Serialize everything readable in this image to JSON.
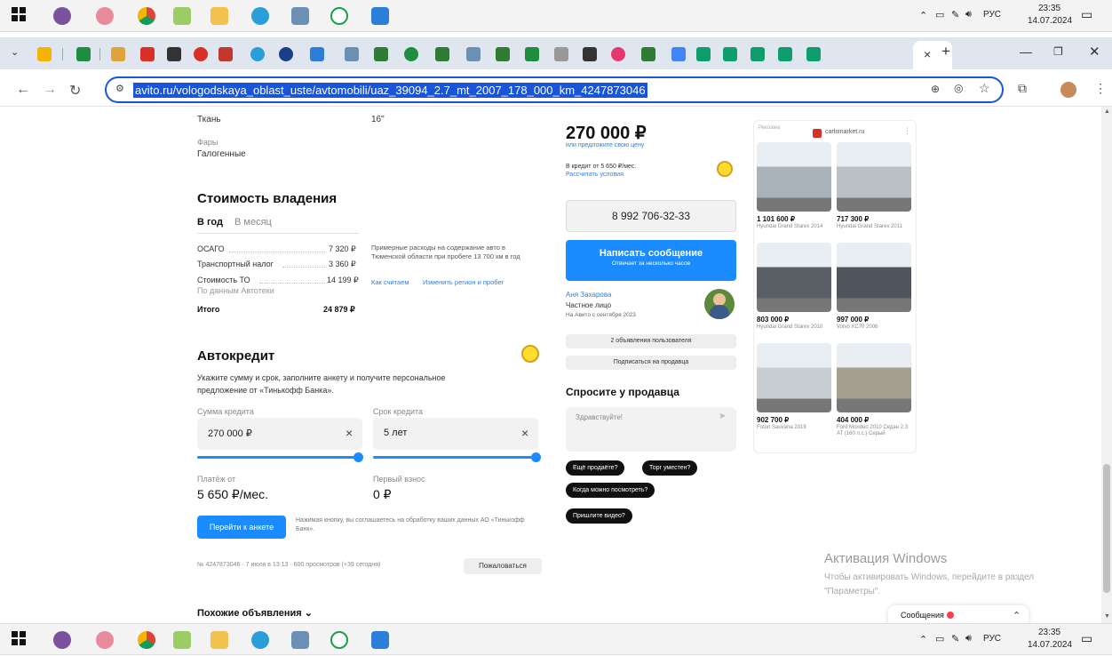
{
  "taskbar": {
    "lang": "РУС",
    "time": "23:35",
    "date": "14.07.2024"
  },
  "browser": {
    "url": "avito.ru/vologodskaya_oblast_uste/avtomobili/uaz_39094_2.7_mt_2007_178_000_km_4247873046",
    "close_tab": "×",
    "new_tab": "+"
  },
  "specs": {
    "upholstery_value": "Ткань",
    "wheels_value": "16\"",
    "headlights_label": "Фары",
    "headlights_value": "Галогенные"
  },
  "ownership": {
    "title": "Стоимость владения",
    "tab_year": "В год",
    "tab_month": "В месяц",
    "rows": [
      {
        "label": "ОСАГО",
        "value": "7 320 ₽"
      },
      {
        "label": "Транспортный налог",
        "value": "3 360 ₽"
      },
      {
        "label": "Стоимость ТО",
        "value": "14 199 ₽"
      }
    ],
    "source": "По данным Автотеки",
    "total_label": "Итого",
    "total_value": "24 879 ₽",
    "note": "Примерные расходы на содержание авто в Тюменской области при пробеге 13 700 км в год",
    "link_how": "Как считаем",
    "link_change": "Изменить регион и пробег"
  },
  "credit": {
    "title": "Автокредит",
    "desc": "Укажите сумму и срок, заполните анкету и получите персональное предложение от «Тинькофф Банка».",
    "sum_label": "Сумма кредита",
    "sum_value": "270 000 ₽",
    "term_label": "Срок кредита",
    "term_value": "5 лет",
    "clear": "×",
    "payment_label": "Платёж от",
    "payment_value": "5 650 ₽/мес.",
    "first_label": "Первый взнос",
    "first_value": "0 ₽",
    "apply_button": "Перейти к анкете",
    "consent": "Нажимая кнопку, вы соглашаетесь на обработку ваших данных АО «Тинькофф Банк»."
  },
  "footer": {
    "meta": "№ 4247873046 · 7 июля в 13:13 · 600 просмотров (+39 сегодня)",
    "complain": "Пожаловаться",
    "similar": "Похожие объявления ⌄"
  },
  "seller": {
    "price": "270 000 ₽",
    "offer_price": "или предложите свою цену",
    "credit_line": "В кредит от 5 650 ₽/мес.",
    "calc_link": "Рассчитать условия",
    "phone": "8 992 706-32-33",
    "message_button": "Написать сообщение",
    "message_sub": "Отвечает за несколько часов",
    "name": "Аня Захарова",
    "type": "Частное лицо",
    "since": "На Авито с сентября 2023",
    "ads_button": "2 объявления пользователя",
    "subscribe_button": "Подписаться на продавца",
    "ask_title": "Спросите у продавца",
    "ask_placeholder": "Здравствуйте!",
    "quick": [
      "Ещё продаёте?",
      "Торг уместен?",
      "Когда можно посмотреть?",
      "Пришлите видео?"
    ]
  },
  "ads": {
    "label": "Реклама",
    "site": "carlsmarket.ru",
    "items": [
      {
        "price": "1 101 600 ₽",
        "sub": "Hyundai Grand Starex 2014",
        "color": "#a9b2b8"
      },
      {
        "price": "717 300 ₽",
        "sub": "Hyundai Grand Starex 2011",
        "color": "#b9c0c6"
      },
      {
        "price": "803 000 ₽",
        "sub": "Hyundai Grand Starex 2010",
        "color": "#5a5f66"
      },
      {
        "price": "997 000 ₽",
        "sub": "Volvo XC70 2006",
        "color": "#4f555c"
      },
      {
        "price": "902 700 ₽",
        "sub": "Foton Sauvana 2019",
        "color": "#c9ced2"
      },
      {
        "price": "404 000 ₽",
        "sub": "Ford Mondeo 2010 Седан 2.3 AT (160 л.с.) Серый",
        "color": "#a59f91"
      }
    ]
  },
  "windows": {
    "activate_title": "Активация Windows",
    "activate_text": "Чтобы активировать Windows, перейдите в раздел \"Параметры\"."
  },
  "messages": {
    "label": "Сообщения",
    "chevron": "⌃"
  },
  "colors": {
    "accent": "#1a8cff",
    "link": "#2f7de1",
    "dark_chip": "#111111"
  }
}
